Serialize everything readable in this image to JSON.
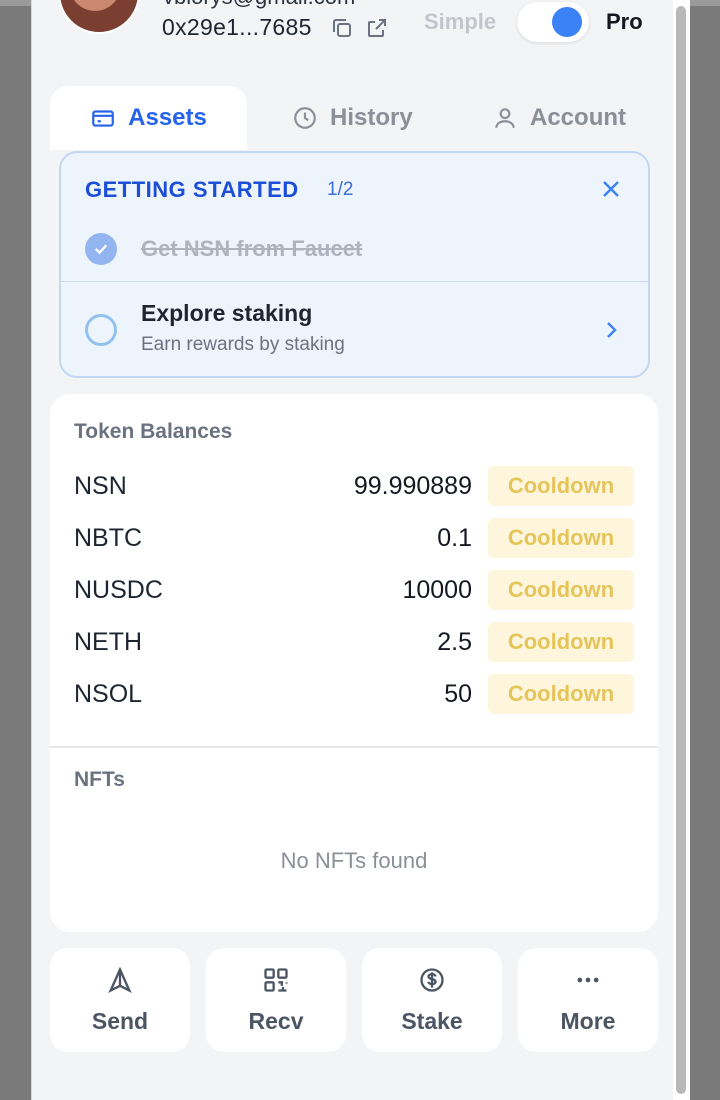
{
  "header": {
    "email": "vblorys@gmail.com",
    "address": "0x29e1...7685",
    "mode_simple_label": "Simple",
    "mode_pro_label": "Pro",
    "toggle_state": "pro"
  },
  "tabs": [
    {
      "label": "Assets",
      "icon": "wallet-icon",
      "active": true
    },
    {
      "label": "History",
      "icon": "clock-icon",
      "active": false
    },
    {
      "label": "Account",
      "icon": "user-icon",
      "active": false
    }
  ],
  "getting_started": {
    "title": "GETTING STARTED",
    "progress": "1/2",
    "steps": [
      {
        "title": "Get NSN from Faucet",
        "done": true
      },
      {
        "title": "Explore staking",
        "subtitle": "Earn rewards by staking",
        "done": false
      }
    ]
  },
  "balances": {
    "title": "Token Balances",
    "tokens": [
      {
        "symbol": "NSN",
        "amount": "99.990889",
        "status": "Cooldown"
      },
      {
        "symbol": "NBTC",
        "amount": "0.1",
        "status": "Cooldown"
      },
      {
        "symbol": "NUSDC",
        "amount": "10000",
        "status": "Cooldown"
      },
      {
        "symbol": "NETH",
        "amount": "2.5",
        "status": "Cooldown"
      },
      {
        "symbol": "NSOL",
        "amount": "50",
        "status": "Cooldown"
      }
    ],
    "nfts_title": "NFTs",
    "nfts_empty": "No NFTs found"
  },
  "actions": [
    {
      "label": "Send",
      "icon": "send-icon"
    },
    {
      "label": "Recv",
      "icon": "qr-code-icon"
    },
    {
      "label": "Stake",
      "icon": "dollar-coin-icon"
    },
    {
      "label": "More",
      "icon": "more-dots-icon"
    }
  ],
  "colors": {
    "accent": "#2563eb",
    "toggle_on": "#3b82f6",
    "cooldown_bg": "#fdf6dc",
    "cooldown_text": "#e5c55a",
    "panel_bg": "#f3f4f6"
  }
}
